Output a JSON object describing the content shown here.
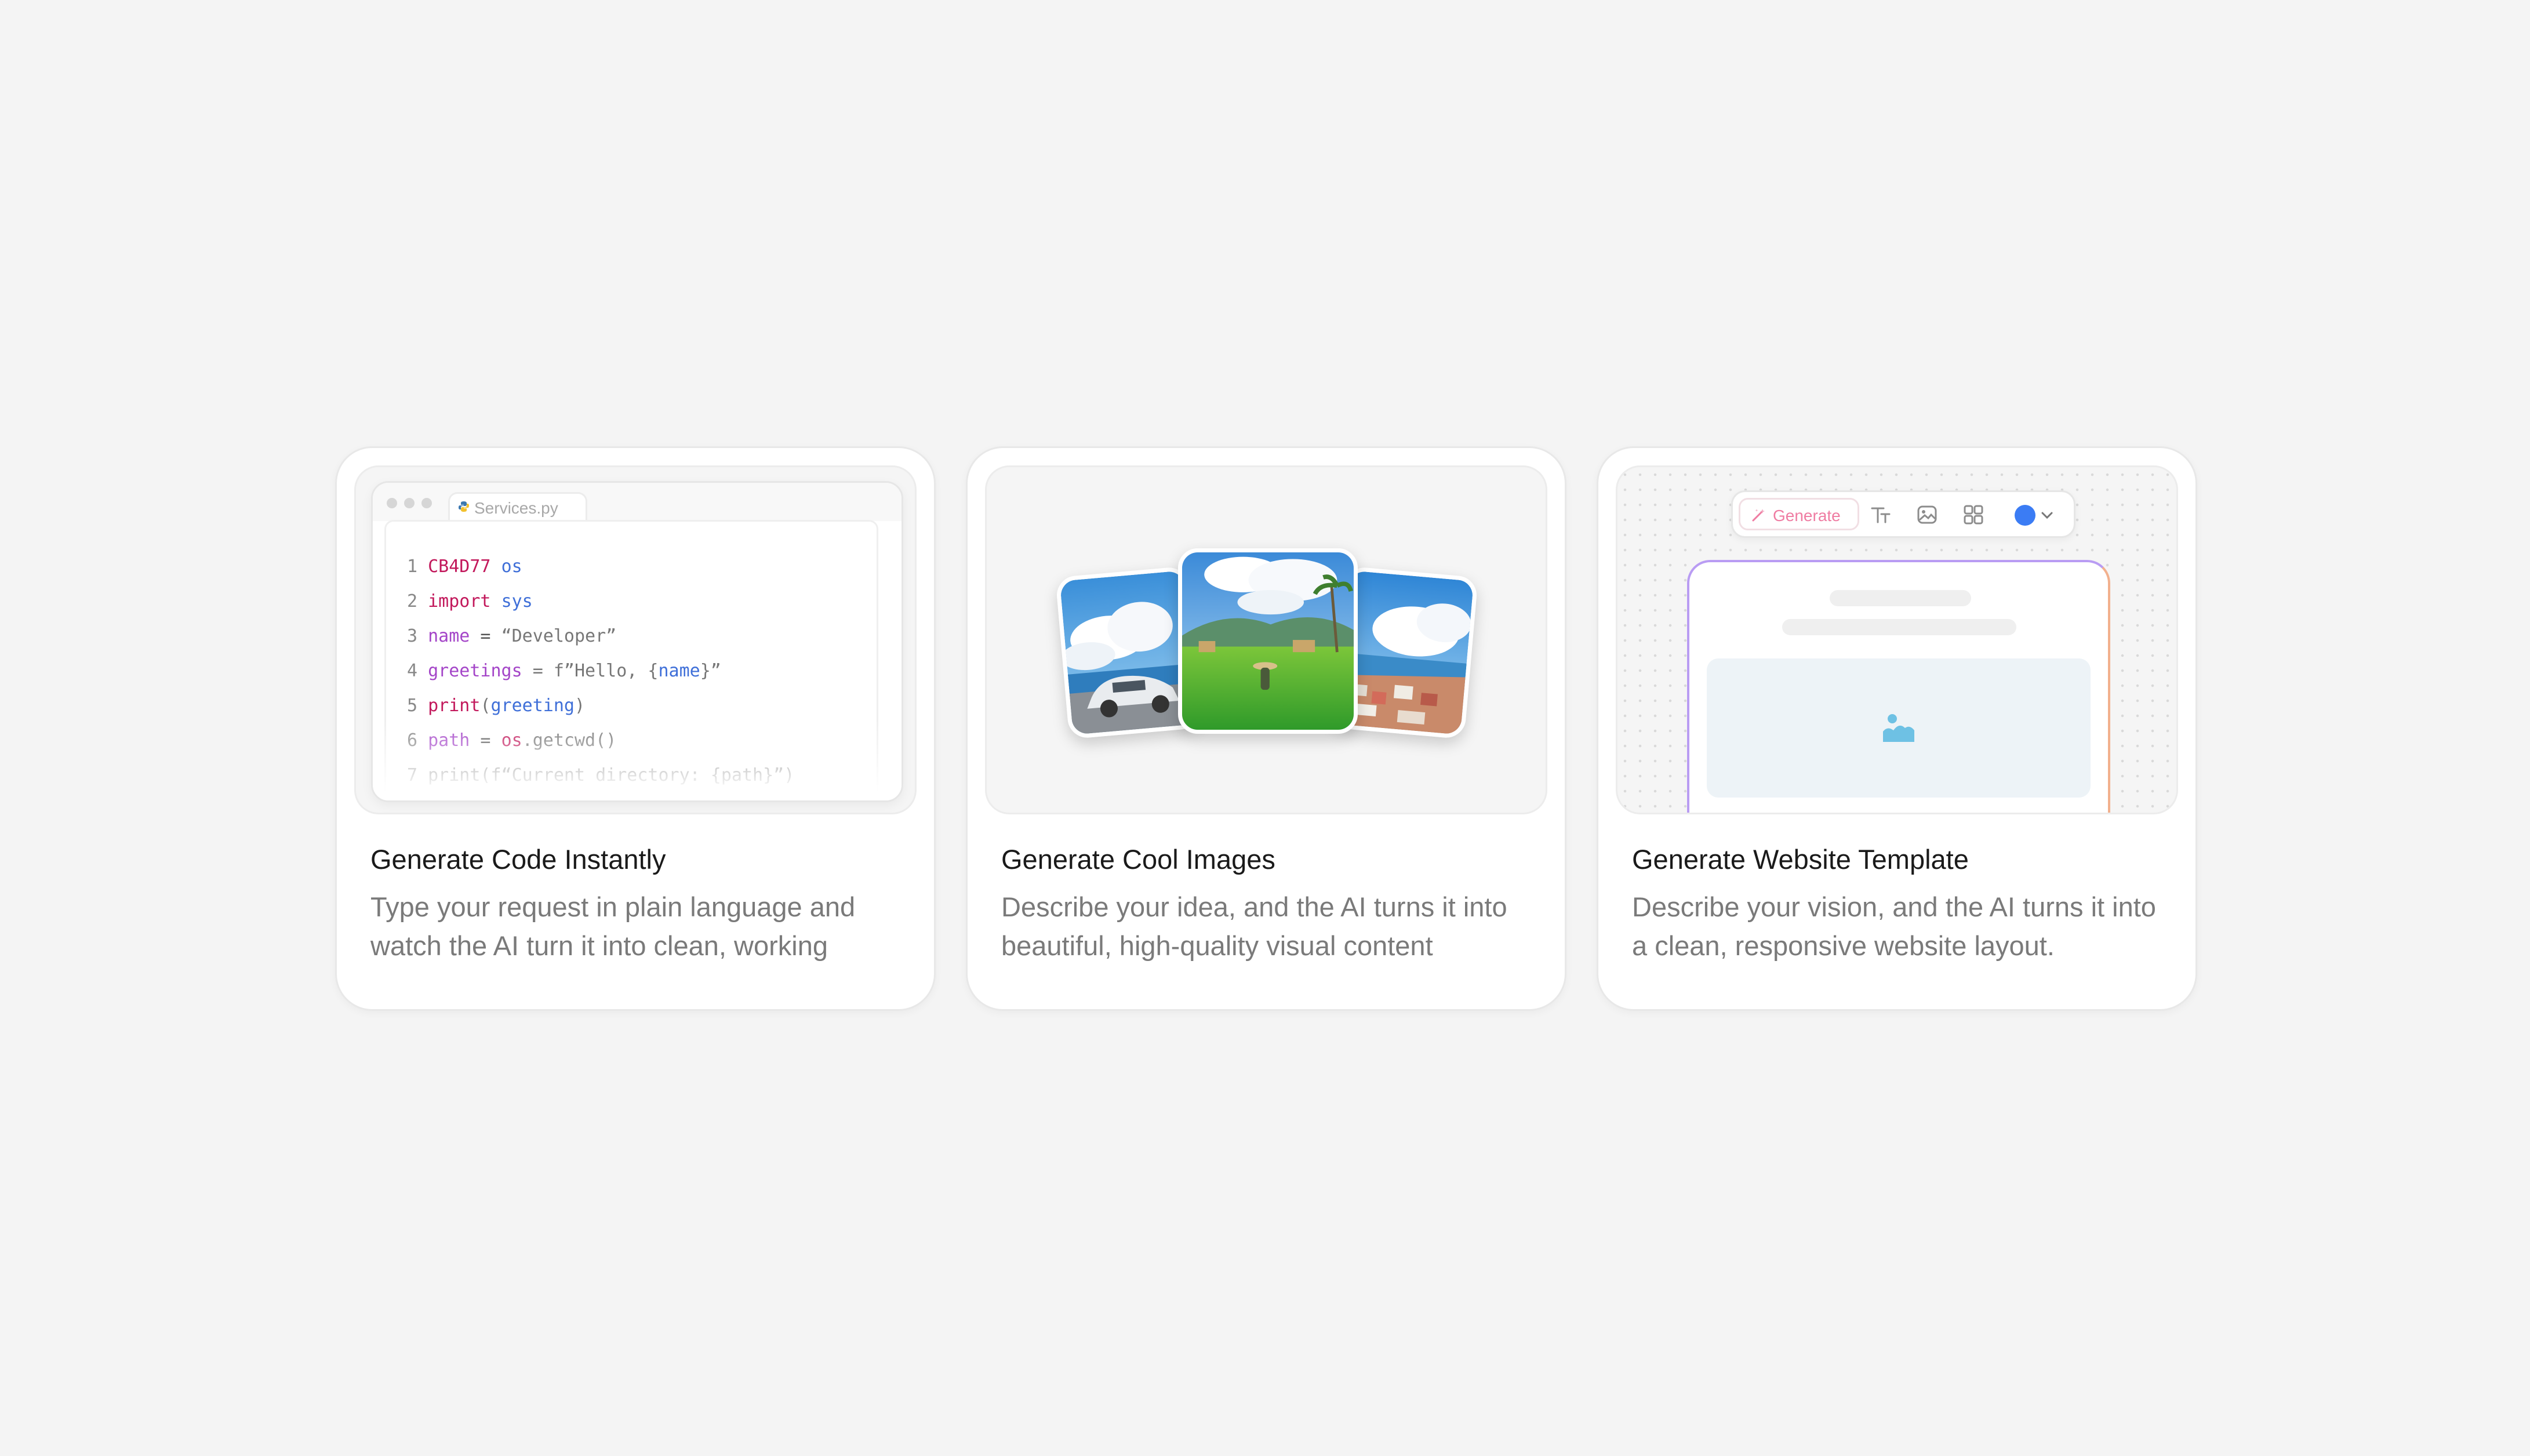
{
  "cards": [
    {
      "title": "Generate Code Instantly",
      "description": "Type your request in plain language and watch the AI turn it into clean, working",
      "editor": {
        "filename": "Services.py",
        "lines": [
          {
            "num": "1",
            "parts": [
              {
                "text": "CB4D77",
                "cls": "kw"
              },
              {
                "text": " ",
                "cls": ""
              },
              {
                "text": "os",
                "cls": "mod"
              }
            ]
          },
          {
            "num": "2",
            "parts": [
              {
                "text": "import",
                "cls": "kw"
              },
              {
                "text": " ",
                "cls": ""
              },
              {
                "text": "sys",
                "cls": "mod"
              }
            ]
          },
          {
            "num": "3",
            "parts": [
              {
                "text": "name",
                "cls": "var"
              },
              {
                "text": " = ",
                "cls": ""
              },
              {
                "text": "“Developer”",
                "cls": "str"
              }
            ]
          },
          {
            "num": "4",
            "parts": [
              {
                "text": "greetings",
                "cls": "var"
              },
              {
                "text": " = f”Hello, {",
                "cls": "str"
              },
              {
                "text": "name",
                "cls": "mod"
              },
              {
                "text": "}”",
                "cls": "str"
              }
            ]
          },
          {
            "num": "5",
            "parts": [
              {
                "text": "print",
                "cls": "kw"
              },
              {
                "text": "(",
                "cls": "str"
              },
              {
                "text": "greeting",
                "cls": "mod"
              },
              {
                "text": ")",
                "cls": "str"
              }
            ]
          },
          {
            "num": "6",
            "parts": [
              {
                "text": "path",
                "cls": "var"
              },
              {
                "text": " = ",
                "cls": ""
              },
              {
                "text": "os",
                "cls": "kw"
              },
              {
                "text": ".getcwd()",
                "cls": "str"
              }
            ]
          },
          {
            "num": "7",
            "parts": [
              {
                "text": "print(f“Current directory: {path}”)",
                "cls": "str"
              }
            ]
          }
        ]
      }
    },
    {
      "title": "Generate Cool Images",
      "description": "Describe your idea, and the AI turns it into beautiful, high-quality visual content"
    },
    {
      "title": "Generate Website Template",
      "description": "Describe your vision, and the AI turns it into a clean, responsive website layout.",
      "toolbar": {
        "generate_label": "Generate",
        "icons": [
          "text-icon",
          "image-icon",
          "grid-icon"
        ],
        "color_swatch": "#3b7cf4"
      }
    }
  ],
  "colors": {
    "page_bg": "#f4f4f4",
    "accent_pink": "#ef7ca2",
    "accent_purple": "#b99cf3",
    "accent_orange": "#f2b08d",
    "placeholder_icon": "#6ec1e4"
  }
}
